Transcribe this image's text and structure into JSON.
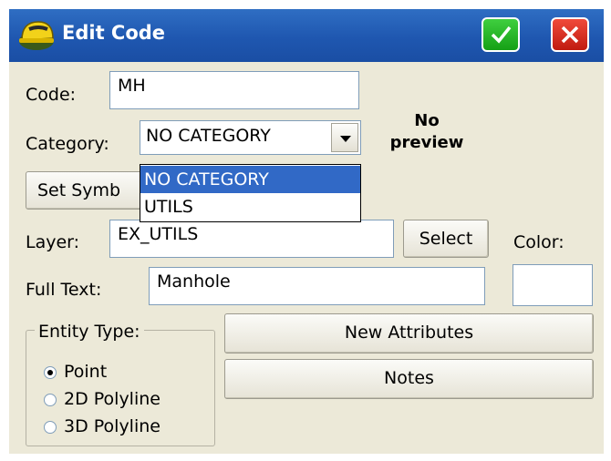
{
  "window": {
    "title": "Edit Code"
  },
  "titlebar": {
    "ok_icon": "checkmark-icon",
    "cancel_icon": "close-icon",
    "app_icon": "hardhat-icon"
  },
  "code": {
    "label": "Code:",
    "value": "MH"
  },
  "category": {
    "label": "Category:",
    "value": "NO CATEGORY",
    "options": [
      "NO CATEGORY",
      "UTILS"
    ],
    "selected_option": "NO CATEGORY"
  },
  "preview": {
    "line1": "No",
    "line2": "preview"
  },
  "set_symbol": {
    "label_visible": "Set Symb"
  },
  "layer": {
    "label": "Layer:",
    "value": "EX_UTILS",
    "select_button": "Select"
  },
  "color": {
    "label": "Color:"
  },
  "full_text": {
    "label": "Full Text:",
    "value": "Manhole"
  },
  "entity_type": {
    "label": "Entity Type:",
    "options": [
      "Point",
      "2D Polyline",
      "3D Polyline"
    ],
    "selected": "Point"
  },
  "buttons": {
    "new_attributes": "New Attributes",
    "notes": "Notes"
  }
}
